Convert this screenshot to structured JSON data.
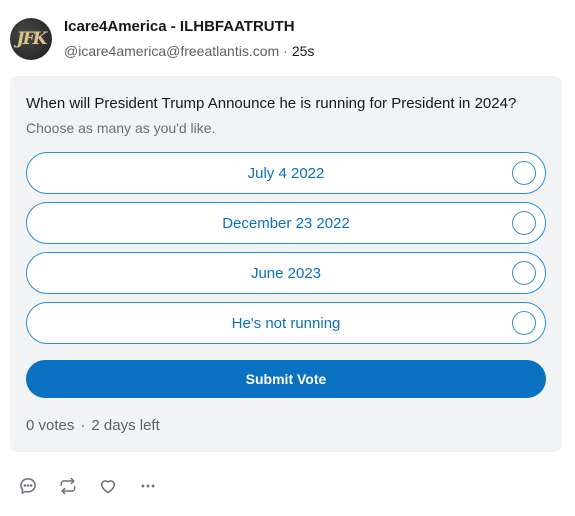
{
  "post": {
    "avatar_initials": "JFK",
    "display_name": "Icare4America - ILHBFAATRUTH",
    "handle": "@icare4america@freeatlantis.com",
    "separator": "·",
    "time": "25s"
  },
  "poll": {
    "question": "When will President Trump Announce he is running for President in 2024?",
    "hint": "Choose as many as you'd like.",
    "options": [
      {
        "label": "July 4 2022"
      },
      {
        "label": "December 23 2022"
      },
      {
        "label": "June 2023"
      },
      {
        "label": "He's not running"
      }
    ],
    "submit_label": "Submit Vote",
    "votes": "0 votes",
    "separator": "·",
    "time_left": "2 days left"
  },
  "actions": {
    "icons": [
      "reply-icon",
      "repost-icon",
      "like-icon",
      "more-icon"
    ]
  },
  "colors": {
    "accent": "#0a71c0",
    "option_border": "#2c8fd2",
    "option_text": "#0a6fbd",
    "card_bg": "#f2f3f5"
  }
}
